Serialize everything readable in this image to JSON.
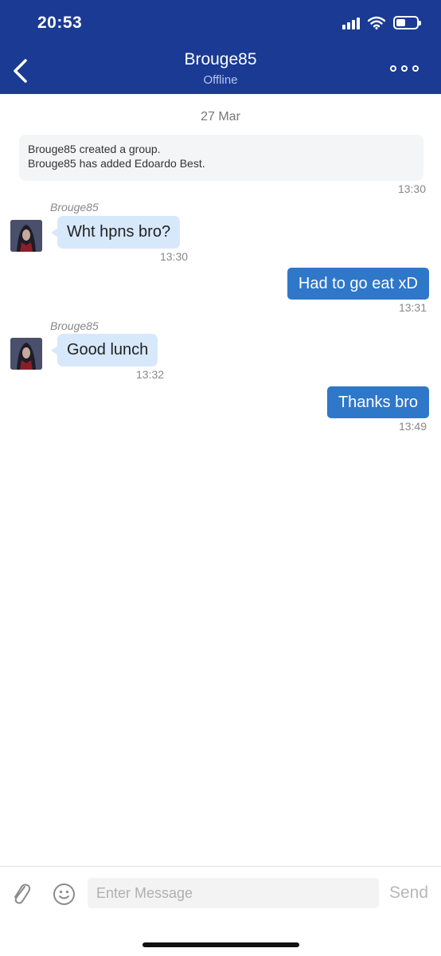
{
  "status_bar": {
    "time": "20:53",
    "battery_level": 0.45
  },
  "header": {
    "title": "Brouge85",
    "subtitle": "Offline",
    "icons": {
      "back": "chevron-left-icon",
      "more": "more-dots-icon"
    }
  },
  "date_separator": "27 Mar",
  "system_message": {
    "lines": [
      "Brouge85 created a group.",
      "Brouge85 has added Edoardo Best."
    ],
    "time": "13:30"
  },
  "messages": [
    {
      "direction": "incoming",
      "sender": "Brouge85",
      "text": "Wht hpns bro?",
      "time": "13:30"
    },
    {
      "direction": "outgoing",
      "text": "Had to go eat xD",
      "time": "13:31"
    },
    {
      "direction": "incoming",
      "sender": "Brouge85",
      "text": "Good lunch",
      "time": "13:32"
    },
    {
      "direction": "outgoing",
      "text": "Thanks bro",
      "time": "13:49"
    }
  ],
  "composer": {
    "placeholder": "Enter Message",
    "value": "",
    "send_label": "Send",
    "icons": {
      "attach": "paperclip-icon",
      "emoji": "smiley-icon"
    }
  },
  "colors": {
    "header_bg": "#1a3a94",
    "incoming_bubble": "#d7e8fb",
    "outgoing_bubble": "#2f77c9"
  }
}
